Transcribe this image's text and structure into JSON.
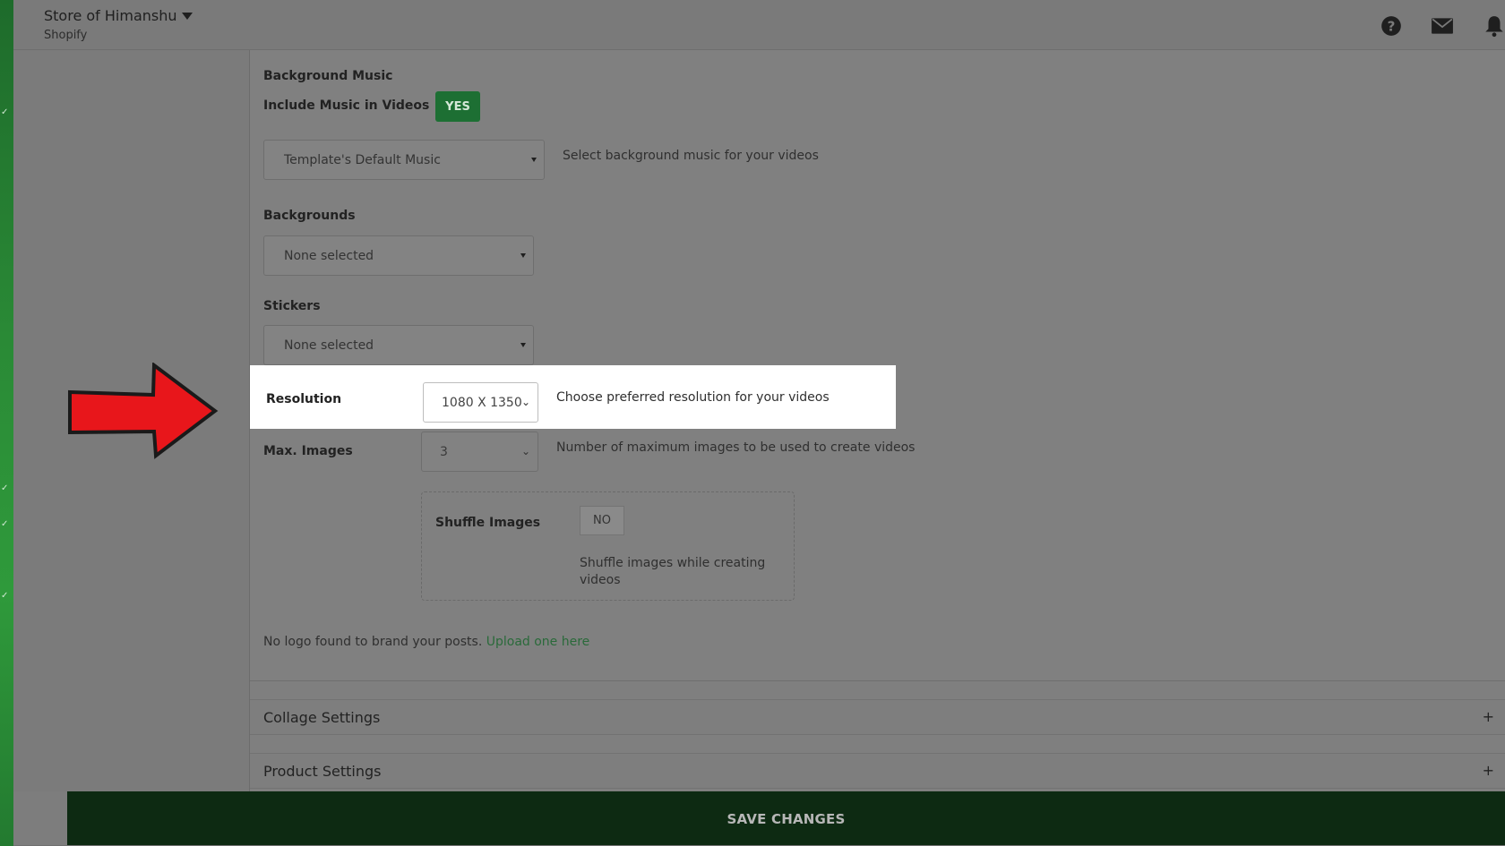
{
  "header": {
    "store_name": "Store of Himanshu",
    "platform": "Shopify"
  },
  "background_music": {
    "heading": "Background Music",
    "include_label": "Include Music in Videos",
    "include_toggle": "YES",
    "music_select": "Template's Default Music",
    "music_help": "Select background music for your videos"
  },
  "backgrounds": {
    "label": "Backgrounds",
    "select": "None selected"
  },
  "stickers": {
    "label": "Stickers",
    "select": "None selected"
  },
  "resolution": {
    "label": "Resolution",
    "value": "1080 X 1350",
    "help": "Choose preferred resolution for your videos"
  },
  "max_images": {
    "label": "Max. Images",
    "value": "3",
    "help": "Number of maximum images to be used to create videos"
  },
  "shuffle": {
    "label": "Shuffle Images",
    "toggle": "NO",
    "help": "Shuffle images while creating videos"
  },
  "logo": {
    "text": "No logo found to brand your posts.",
    "link": "Upload one here"
  },
  "sections": {
    "collage": "Collage Settings",
    "product": "Product Settings",
    "expand_symbol": "+"
  },
  "footer": {
    "save_label": "SAVE CHANGES"
  },
  "icons": {
    "help": "help-circle-icon",
    "mail": "mail-icon",
    "bell": "bell-icon",
    "arrow": "red-arrow-pointer"
  },
  "colors": {
    "accent_green": "#1d6f33",
    "save_bar": "#0d2a12",
    "arrow_red": "#e8161b"
  }
}
